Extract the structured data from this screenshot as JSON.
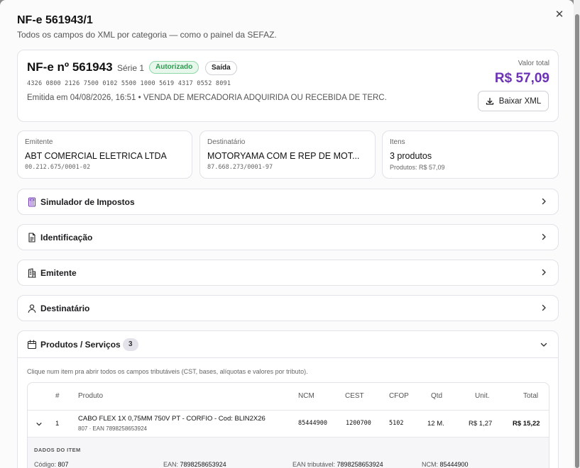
{
  "modal": {
    "title": "NF-e 561943/1",
    "subtitle": "Todos os campos do XML por categoria — como o painel da SEFAZ."
  },
  "summary": {
    "title": "NF-e nº 561943",
    "serie": "Série 1",
    "status_badge": "Autorizado",
    "type_badge": "Saída",
    "chave": "4326 0800 2126 7500 0102 5500 1000 5619 4317 0552 8091",
    "emitida": "Emitida em 04/08/2026, 16:51 • VENDA DE MERCADORIA ADQUIRIDA OU RECEBIDA DE TERC.",
    "valor_label": "Valor total",
    "valor": "R$ 57,09",
    "download_label": "Baixar XML"
  },
  "emitente": {
    "label": "Emitente",
    "name": "ABT COMERCIAL ELETRICA LTDA",
    "doc": "00.212.675/0001-02"
  },
  "destinatario": {
    "label": "Destinatário",
    "name": "MOTORYAMA COM E REP DE MOT...",
    "doc": "87.668.273/0001-97"
  },
  "itens": {
    "label": "Itens",
    "count": "3 produtos",
    "sub": "Produtos: R$ 57,09"
  },
  "sections": [
    {
      "title": "Simulador de Impostos",
      "icon": "calculator-icon"
    },
    {
      "title": "Identificação",
      "icon": "document-icon"
    },
    {
      "title": "Emitente",
      "icon": "building-icon"
    },
    {
      "title": "Destinatário",
      "icon": "user-icon"
    }
  ],
  "produtos": {
    "title": "Produtos / Serviços",
    "count": "3",
    "hint": "Clique num item pra abrir todos os campos tributáveis (CST, bases, alíquotas e valores por tributo).",
    "columns": [
      "#",
      "Produto",
      "NCM",
      "CEST",
      "CFOP",
      "Qtd",
      "Unit.",
      "Total"
    ],
    "rows": [
      {
        "num": "1",
        "produto": "CABO FLEX 1X 0,75MM 750V PT - CORFIO - Cod: BLIN2X26",
        "produto_sub": "807 · EAN 7898258653924",
        "ncm": "85444900",
        "cest": "1200700",
        "cfop": "5102",
        "qtd": "12 M.",
        "unit": "R$ 1,27",
        "total": "R$ 15,22"
      }
    ],
    "detail": {
      "title": "DADOS DO ITEM",
      "codigo_label": "Código:",
      "codigo": "807",
      "ean_label": "EAN:",
      "ean": "7898258653924",
      "ean_trib_label": "EAN tributável:",
      "ean_trib": "7898258653924",
      "ncm_label": "NCM:",
      "ncm": "85444900"
    }
  },
  "colors": {
    "accent": "#6c33b5",
    "success": "#2b9b4f"
  }
}
